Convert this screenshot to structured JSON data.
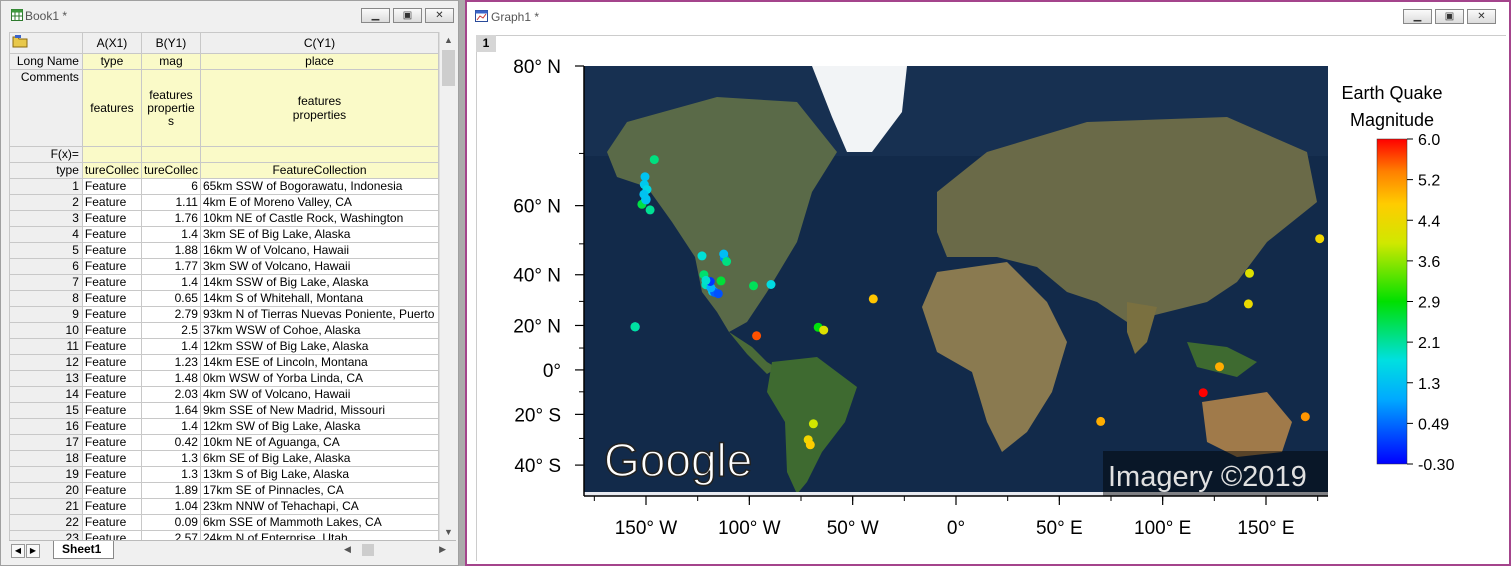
{
  "book": {
    "title": "Book1 *",
    "columns": [
      "A(X1)",
      "B(Y1)",
      "C(Y1)"
    ],
    "label_rows": {
      "long_name": {
        "label": "Long Name",
        "values": [
          "type",
          "mag",
          "place"
        ]
      },
      "comments": {
        "label": "Comments",
        "values": [
          "features",
          "features propertie s",
          "features properties"
        ]
      },
      "fx": {
        "label": "F(x)="
      },
      "type": {
        "label": "type",
        "values": [
          "tureCollec",
          "tureCollec",
          "FeatureCollection"
        ]
      }
    },
    "rows": [
      {
        "n": "1",
        "type": "Feature",
        "mag": "6",
        "place": "65km SSW of Bogorawatu, Indonesia"
      },
      {
        "n": "2",
        "type": "Feature",
        "mag": "1.11",
        "place": "4km E of Moreno Valley, CA"
      },
      {
        "n": "3",
        "type": "Feature",
        "mag": "1.76",
        "place": "10km NE of Castle Rock, Washington"
      },
      {
        "n": "4",
        "type": "Feature",
        "mag": "1.4",
        "place": "3km SE of Big Lake, Alaska"
      },
      {
        "n": "5",
        "type": "Feature",
        "mag": "1.88",
        "place": "16km W of Volcano, Hawaii"
      },
      {
        "n": "6",
        "type": "Feature",
        "mag": "1.77",
        "place": "3km SW of Volcano, Hawaii"
      },
      {
        "n": "7",
        "type": "Feature",
        "mag": "1.4",
        "place": "14km SSW of Big Lake, Alaska"
      },
      {
        "n": "8",
        "type": "Feature",
        "mag": "0.65",
        "place": "14km S of Whitehall, Montana"
      },
      {
        "n": "9",
        "type": "Feature",
        "mag": "2.79",
        "place": "93km N of Tierras Nuevas Poniente, Puerto"
      },
      {
        "n": "10",
        "type": "Feature",
        "mag": "2.5",
        "place": "37km WSW of Cohoe, Alaska"
      },
      {
        "n": "11",
        "type": "Feature",
        "mag": "1.4",
        "place": "12km SSW of Big Lake, Alaska"
      },
      {
        "n": "12",
        "type": "Feature",
        "mag": "1.23",
        "place": "14km ESE of Lincoln, Montana"
      },
      {
        "n": "13",
        "type": "Feature",
        "mag": "1.48",
        "place": "0km WSW of Yorba Linda, CA"
      },
      {
        "n": "14",
        "type": "Feature",
        "mag": "2.03",
        "place": "4km SW of Volcano, Hawaii"
      },
      {
        "n": "15",
        "type": "Feature",
        "mag": "1.64",
        "place": "9km SSE of New Madrid, Missouri"
      },
      {
        "n": "16",
        "type": "Feature",
        "mag": "1.4",
        "place": "12km SW of Big Lake, Alaska"
      },
      {
        "n": "17",
        "type": "Feature",
        "mag": "0.42",
        "place": "10km NE of Aguanga, CA"
      },
      {
        "n": "18",
        "type": "Feature",
        "mag": "1.3",
        "place": "6km SE of Big Lake, Alaska"
      },
      {
        "n": "19",
        "type": "Feature",
        "mag": "1.3",
        "place": "13km S of Big Lake, Alaska"
      },
      {
        "n": "20",
        "type": "Feature",
        "mag": "1.89",
        "place": "17km SE of Pinnacles, CA"
      },
      {
        "n": "21",
        "type": "Feature",
        "mag": "1.04",
        "place": "23km NNW of Tehachapi, CA"
      },
      {
        "n": "22",
        "type": "Feature",
        "mag": "0.09",
        "place": "6km SSE of Mammoth Lakes, CA"
      },
      {
        "n": "23",
        "type": "Feature",
        "mag": "2.57",
        "place": "24km N of Enterprise, Utah"
      }
    ],
    "sheet_tab": "Sheet1"
  },
  "graph": {
    "title": "Graph1 *",
    "layer": "1",
    "watermark": "Google",
    "imagery": "Imagery ©2019"
  },
  "chart_data": {
    "type": "scatter",
    "title": "",
    "xlabel": "",
    "ylabel": "",
    "xlim": [
      -180,
      180
    ],
    "ylim": [
      -50,
      80
    ],
    "x_ticks": [
      "150° W",
      "100° W",
      "50° W",
      "0°",
      "50° E",
      "100° E",
      "150° E"
    ],
    "x_tick_values": [
      -150,
      -100,
      -50,
      0,
      50,
      100,
      150
    ],
    "y_ticks": [
      "80° N",
      "60° N",
      "40° N",
      "20° N",
      "0°",
      "20° S",
      "40° S"
    ],
    "y_tick_values": [
      80,
      60,
      40,
      20,
      0,
      -20,
      -40
    ],
    "colorbar": {
      "title_lines": [
        "Earth Quake",
        "Magnitude"
      ],
      "tick_labels": [
        "6.0",
        "5.2",
        "4.4",
        "3.6",
        "2.9",
        "2.1",
        "1.3",
        "0.49",
        "-0.30"
      ],
      "range": [
        -0.3,
        6.0
      ]
    },
    "points": [
      {
        "x": 119.6,
        "y": -10.4,
        "mag": 6.0
      },
      {
        "x": -117.2,
        "y": 33.9,
        "mag": 1.11
      },
      {
        "x": -122.9,
        "y": 46.3,
        "mag": 1.76
      },
      {
        "x": -150.0,
        "y": 61.5,
        "mag": 1.4
      },
      {
        "x": -155.3,
        "y": 19.4,
        "mag": 1.88
      },
      {
        "x": -155.2,
        "y": 19.4,
        "mag": 1.77
      },
      {
        "x": -150.1,
        "y": 61.3,
        "mag": 1.4
      },
      {
        "x": -112.1,
        "y": 45.7,
        "mag": 0.65
      },
      {
        "x": -66.7,
        "y": 19.2,
        "mag": 2.79
      },
      {
        "x": -152.0,
        "y": 60.3,
        "mag": 2.5
      },
      {
        "x": -150.1,
        "y": 61.4,
        "mag": 1.4
      },
      {
        "x": -112.4,
        "y": 46.9,
        "mag": 1.23
      },
      {
        "x": -117.8,
        "y": 33.9,
        "mag": 1.48
      },
      {
        "x": -155.3,
        "y": 19.4,
        "mag": 2.03
      },
      {
        "x": -89.5,
        "y": 36.5,
        "mag": 1.64
      },
      {
        "x": -150.2,
        "y": 61.4,
        "mag": 1.4
      },
      {
        "x": -116.8,
        "y": 33.5,
        "mag": 0.42
      },
      {
        "x": -149.9,
        "y": 61.4,
        "mag": 1.3
      },
      {
        "x": -150.0,
        "y": 61.3,
        "mag": 1.3
      },
      {
        "x": -121.0,
        "y": 36.4,
        "mag": 1.89
      },
      {
        "x": -118.6,
        "y": 35.3,
        "mag": 1.04
      },
      {
        "x": -118.9,
        "y": 37.6,
        "mag": 0.09
      },
      {
        "x": -113.7,
        "y": 37.8,
        "mag": 2.57
      },
      {
        "x": -146.0,
        "y": 69.0,
        "mag": 2.2
      },
      {
        "x": -150.5,
        "y": 66.0,
        "mag": 1.3
      },
      {
        "x": -150.8,
        "y": 64.5,
        "mag": 1.4
      },
      {
        "x": -149.5,
        "y": 63.5,
        "mag": 1.6
      },
      {
        "x": -151.0,
        "y": 62.5,
        "mag": 1.3
      },
      {
        "x": -148.0,
        "y": 59.0,
        "mag": 2.1
      },
      {
        "x": -115.0,
        "y": 33.0,
        "mag": 0.3
      },
      {
        "x": -122.0,
        "y": 40.0,
        "mag": 2.3
      },
      {
        "x": -121.0,
        "y": 38.0,
        "mag": 1.8
      },
      {
        "x": -111.0,
        "y": 44.5,
        "mag": 2.2
      },
      {
        "x": -98.0,
        "y": 36.0,
        "mag": 2.4
      },
      {
        "x": -96.5,
        "y": 15.5,
        "mag": 5.6
      },
      {
        "x": -64.0,
        "y": 18.0,
        "mag": 4.2
      },
      {
        "x": -40.0,
        "y": 31.0,
        "mag": 4.8
      },
      {
        "x": -69.0,
        "y": -24.0,
        "mag": 4.0
      },
      {
        "x": -71.5,
        "y": -30.5,
        "mag": 4.5
      },
      {
        "x": -70.5,
        "y": -32.5,
        "mag": 4.7
      },
      {
        "x": 70.0,
        "y": -23.0,
        "mag": 5.0
      },
      {
        "x": 127.5,
        "y": 1.5,
        "mag": 5.0
      },
      {
        "x": 142.0,
        "y": 40.5,
        "mag": 4.2
      },
      {
        "x": 141.5,
        "y": 29.0,
        "mag": 4.4
      },
      {
        "x": 176.0,
        "y": 51.5,
        "mag": 4.5
      },
      {
        "x": 169.0,
        "y": -21.0,
        "mag": 5.2
      }
    ]
  }
}
